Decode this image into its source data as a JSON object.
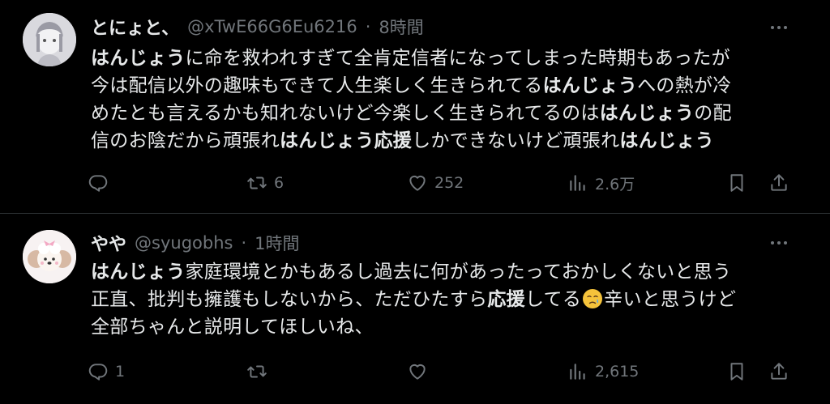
{
  "posts": [
    {
      "display_name": "とにょと、",
      "handle": "@xTwE66G6Eu6216",
      "separator": "·",
      "time": "8時間",
      "avatar_icon": "avatar-drawing-icon",
      "body_lines": [
        [
          {
            "t": "はんじょう",
            "b": true
          },
          {
            "t": "に命を救われすぎて全肯定信者になってしまった時期もあったが"
          }
        ],
        [
          {
            "t": "今は配信以外の趣味もできて人生楽しく生きられてる"
          },
          {
            "t": "はんじょう",
            "b": true
          },
          {
            "t": "への熱が冷"
          }
        ],
        [
          {
            "t": "めたとも言えるかも知れないけど今楽しく生きられてるのは"
          },
          {
            "t": "はんじょう",
            "b": true
          },
          {
            "t": "の配"
          }
        ],
        [
          {
            "t": "信のお陰だから頑張れ"
          },
          {
            "t": "はんじょう応援",
            "b": true
          },
          {
            "t": "しかできないけど頑張れ"
          },
          {
            "t": "はんじょう",
            "b": true
          }
        ]
      ],
      "actions": {
        "reply_count": "",
        "retweet_count": "6",
        "like_count": "252",
        "view_count": "2.6万"
      }
    },
    {
      "display_name": "やや",
      "handle": "@syugobhs",
      "separator": "·",
      "time": "1時間",
      "avatar_icon": "avatar-poodle-icon",
      "body_lines": [
        [
          {
            "t": "はんじょう",
            "b": true
          },
          {
            "t": "家庭環境とかもあるし過去に何があったっておかしくないと思う"
          }
        ],
        [
          {
            "t": "正直、批判も擁護もしないから、ただひたすら"
          },
          {
            "t": "応援",
            "b": true
          },
          {
            "t": "してる"
          },
          {
            "emoji": "crying-face"
          },
          {
            "t": "辛いと思うけど"
          }
        ],
        [
          {
            "t": "全部ちゃんと説明してほしいね、"
          }
        ]
      ],
      "actions": {
        "reply_count": "1",
        "retweet_count": "",
        "like_count": "",
        "view_count": "2,615"
      }
    }
  ],
  "colors": {
    "background": "#000000",
    "text": "#e7e9ea",
    "secondary": "#71767b",
    "divider": "#2f3336"
  }
}
